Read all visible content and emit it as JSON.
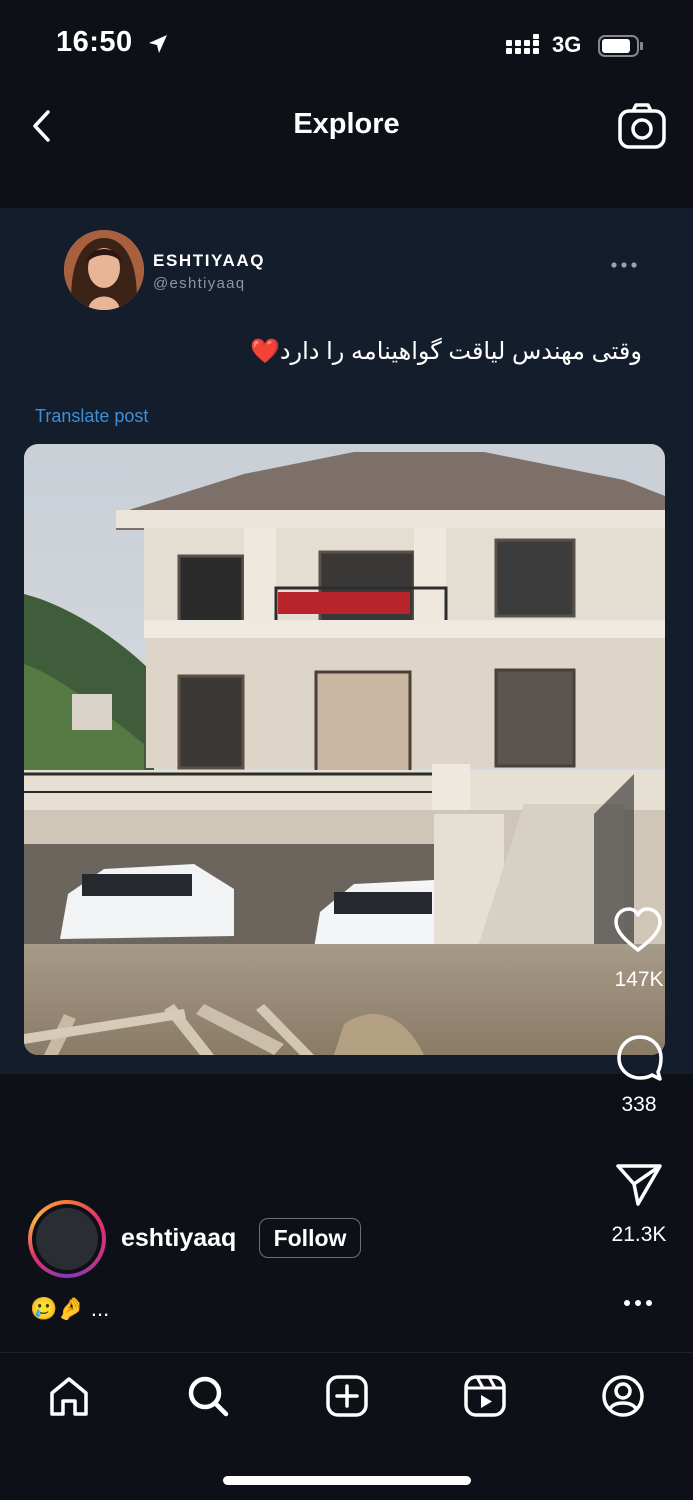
{
  "status_bar": {
    "time": "16:50",
    "network": "3G"
  },
  "header": {
    "title": "Explore"
  },
  "embedded_post": {
    "author_name": "ESHTIYAAQ",
    "author_handle": "@eshtiyaaq",
    "text": "وقتی مهندس لیاقت گواهینامه را دارد❤️",
    "translate_label": "Translate post"
  },
  "actions": {
    "likes": "147K",
    "comments": "338",
    "shares": "21.3K"
  },
  "author_row": {
    "username": "eshtiyaaq",
    "follow_label": "Follow"
  },
  "caption": {
    "text": "🥲🤌 ..."
  },
  "tabs": [
    "home-icon",
    "search-icon",
    "create-icon",
    "reels-icon",
    "profile-icon"
  ],
  "colors": {
    "background": "#0d1117",
    "card": "#141d2b",
    "link": "#3e8fd5"
  }
}
